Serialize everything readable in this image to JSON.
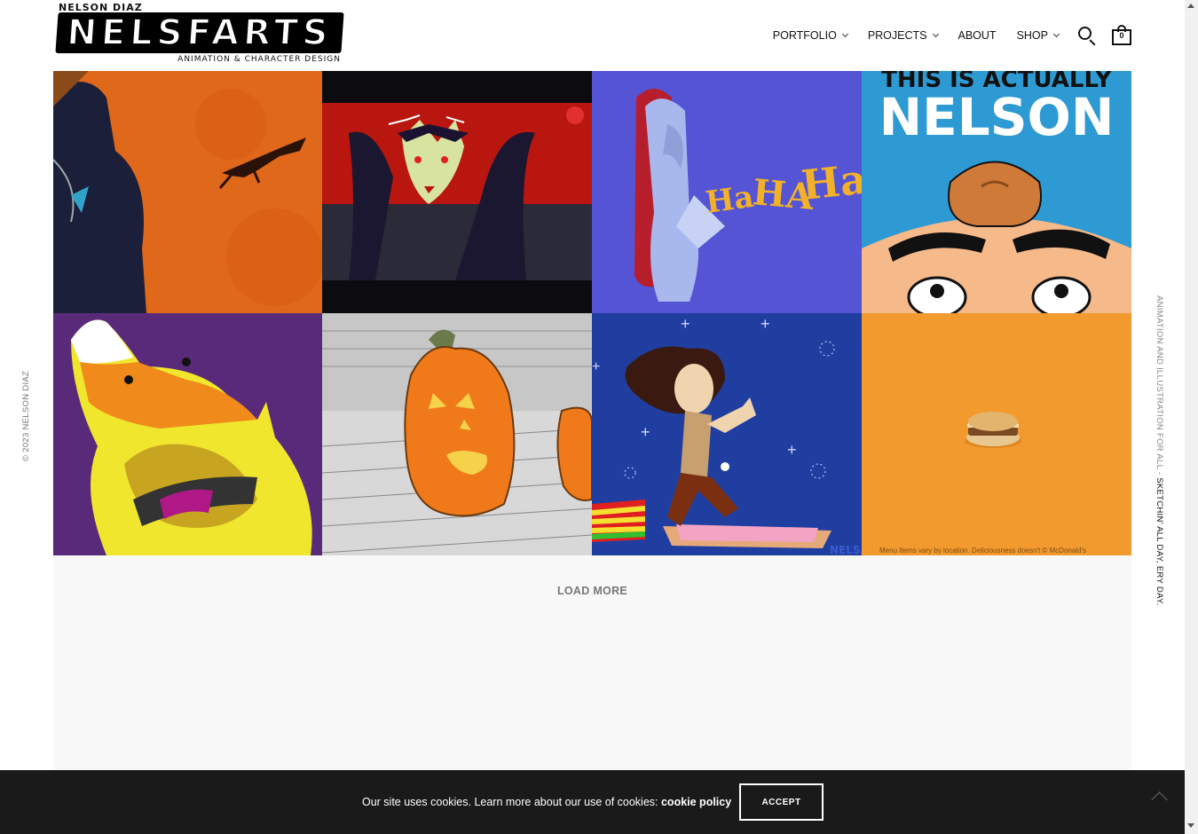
{
  "logo": {
    "top_text": "NELSON DIAZ",
    "wordmark": "NELSFARTS",
    "subtitle": "ANIMATION & CHARACTER DESIGN"
  },
  "nav": {
    "items": [
      {
        "label": "PORTFOLIO",
        "has_dropdown": true
      },
      {
        "label": "PROJECTS",
        "has_dropdown": true
      },
      {
        "label": "ABOUT",
        "has_dropdown": false
      },
      {
        "label": "SHOP",
        "has_dropdown": true
      }
    ],
    "search_icon": "search-icon",
    "cart_icon": "shopping-bag-icon",
    "cart_count": "0"
  },
  "grid": {
    "tiles": [
      {
        "name": "samurai-horse-artwork",
        "bg": "#e06a1a"
      },
      {
        "name": "vampire-artwork",
        "bg": "#b81a14"
      },
      {
        "name": "ha-ha-ha-artwork",
        "bg": "#5656d6",
        "text": "HA HA HA"
      },
      {
        "name": "this-is-actually-nelson-artwork",
        "bg": "#2e9bd4",
        "text_line1": "THIS IS ACTUALLY",
        "text_line2": "NELSON"
      },
      {
        "name": "candy-corn-monster-artwork",
        "bg": "#5a2a7a"
      },
      {
        "name": "jack-o-lantern-artwork",
        "bg": "#cfcfcf"
      },
      {
        "name": "rock-wizard-artwork",
        "bg": "#1f3ea0",
        "watermark": "NELSAR"
      },
      {
        "name": "breakfast-sandwich-artwork",
        "bg": "#f29a2e",
        "caption": "Menu Items vary by location. Deliciousness doesn't © McDonald's"
      }
    ]
  },
  "load_more": "LOAD MORE",
  "copyright": "© 2023 NELSON DIAZ",
  "tagline": {
    "part_a": "ANIMATION AND ILLUSTRATION FOR ALL - ",
    "part_b": "SKETCHIN' ALL DAY, ERY DAY."
  },
  "cookie": {
    "text": "Our site uses cookies. Learn more about our use of cookies: ",
    "link": "cookie policy",
    "accept": "ACCEPT"
  },
  "colors": {
    "cookie_bg": "#1a1a1a",
    "load_area_bg": "#f8f8f8"
  }
}
